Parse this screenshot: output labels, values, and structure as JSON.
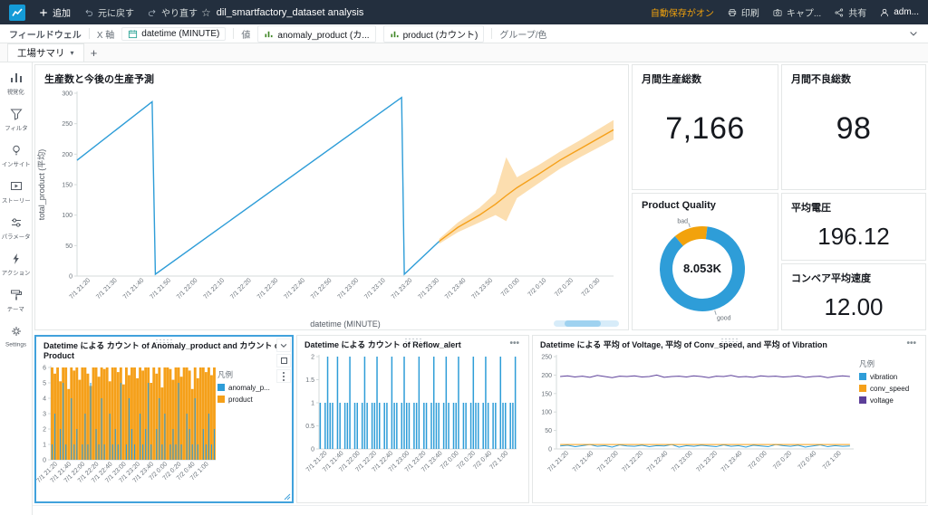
{
  "topbar": {
    "add": "追加",
    "undo": "元に戻す",
    "redo": "やり直す",
    "title": "dil_smartfactory_dataset analysis",
    "autosave": "自動保存がオン",
    "print": "印刷",
    "capture": "キャプ...",
    "share": "共有",
    "user": "adm..."
  },
  "fieldwells": {
    "label": "フィールドウェル",
    "x_axis": "X 軸",
    "x_field": "datetime (MINUTE)",
    "value_label": "値",
    "value_field_1": "anomaly_product (カ...",
    "value_field_2": "product (カウント)",
    "group_label": "グループ/色"
  },
  "tabs": {
    "active": "工場サマリ",
    "add": "+"
  },
  "sidebar": {
    "items": [
      {
        "label": "視覚化"
      },
      {
        "label": "フィルタ"
      },
      {
        "label": "インサイト"
      },
      {
        "label": "ストーリー"
      },
      {
        "label": "パラメータ"
      },
      {
        "label": "アクション"
      },
      {
        "label": "テーマ"
      },
      {
        "label": "Settings"
      }
    ]
  },
  "kpis": {
    "production": {
      "title": "月間生産総数",
      "value": "7,166"
    },
    "defects": {
      "title": "月間不良総数",
      "value": "98"
    },
    "voltage": {
      "title": "平均電圧",
      "value": "196.12"
    },
    "conveyor": {
      "title": "コンベア平均速度",
      "value": "12.00"
    }
  },
  "charts": {
    "bottom_xlabels": [
      "7/1 21:20",
      "7/1 21:40",
      "7/1 22:00",
      "7/1 22:20",
      "7/1 22:40",
      "7/1 23:00",
      "7/1 23:20",
      "7/1 23:40",
      "7/2 0:00",
      "7/2 0:20",
      "7/2 0:40",
      "7/2 1:00"
    ],
    "production": {
      "type": "line",
      "title": "生産数と今後の生産予測",
      "ylabel": "total_product (平均)",
      "xlabel": "datetime (MINUTE)",
      "ylim": [
        0,
        300
      ],
      "yticks": [
        0,
        50,
        100,
        150,
        200,
        250,
        300
      ],
      "xlabels": [
        "7/1 21:20",
        "7/1 21:30",
        "7/1 21:40",
        "7/1 21:50",
        "7/1 22:00",
        "7/1 22:10",
        "7/1 22:20",
        "7/1 22:30",
        "7/1 22:40",
        "7/1 22:50",
        "7/1 23:00",
        "7/1 23:10",
        "7/1 23:20",
        "7/1 23:30",
        "7/1 23:40",
        "7/1 23:50",
        "7/2 0:00",
        "7/2 0:10",
        "7/2 0:20",
        "7/2 0:30"
      ],
      "historical": {
        "name": "total_product",
        "color": "#2e9dd8",
        "points": [
          [
            0,
            190
          ],
          [
            14,
            286
          ],
          [
            14.6,
            3
          ],
          [
            60.5,
            293
          ],
          [
            61,
            3
          ],
          [
            67.5,
            57
          ]
        ]
      },
      "forecast": {
        "name": "forecast",
        "color": "#f5a01a",
        "x": [
          67.5,
          71,
          75,
          78,
          80,
          82,
          86,
          90,
          94,
          97,
          100
        ],
        "y": [
          57,
          80,
          100,
          118,
          132,
          145,
          167,
          190,
          210,
          225,
          240
        ],
        "lo": [
          53,
          72,
          88,
          100,
          90,
          128,
          152,
          176,
          196,
          210,
          224
        ],
        "hi": [
          61,
          88,
          112,
          136,
          195,
          162,
          182,
          204,
          224,
          240,
          256
        ]
      }
    },
    "quality": {
      "type": "donut",
      "title": "Product Quality",
      "center": "8.053K",
      "start_angle": -40,
      "slices": [
        {
          "label": "bad",
          "value": 13,
          "color": "#f2a20c"
        },
        {
          "label": "good",
          "value": 87,
          "color": "#2e9dd8"
        }
      ]
    },
    "anomaly": {
      "type": "bar",
      "title": "Datetime による カウント of Anomaly_product and カウント of Product",
      "ylim": [
        0,
        6
      ],
      "yticks": [
        0,
        1,
        2,
        3,
        4,
        5,
        6
      ],
      "legend_title": "凡例",
      "legend": [
        {
          "label": "anomaly_p...",
          "color": "#2e9dd8"
        },
        {
          "label": "product",
          "color": "#f5a01a"
        }
      ],
      "series": [
        {
          "name": "product",
          "color": "#f5a01a",
          "bw": 0.95,
          "values": [
            6,
            5.6,
            6,
            5.1,
            6,
            6,
            4.6,
            6,
            5.8,
            6,
            5.2,
            6,
            6,
            5.6,
            4.8,
            6,
            6,
            5.4,
            6,
            5.9,
            6,
            5.1,
            6,
            6,
            5.7,
            6,
            4.9,
            6,
            5.5,
            6,
            6,
            5.3,
            6,
            5.8,
            6,
            6,
            5,
            6,
            5.6,
            6,
            4.7,
            6,
            6,
            5.9,
            5.2,
            6,
            6,
            5.4,
            6,
            6,
            5.8,
            4.6,
            6,
            5.3,
            6,
            6,
            5.7,
            6,
            5.5,
            6
          ]
        },
        {
          "name": "anomaly_product",
          "color": "#2e9dd8",
          "bw": 0.35,
          "values": [
            1,
            3,
            0,
            2,
            5,
            1,
            0,
            4,
            1,
            2,
            0,
            1,
            3,
            1,
            5,
            0,
            2,
            1,
            4,
            1,
            0,
            3,
            1,
            2,
            1,
            5,
            0,
            1,
            4,
            2,
            1,
            0,
            3,
            1,
            2,
            5,
            1,
            0,
            2,
            4,
            1,
            3,
            0,
            1,
            2,
            1,
            5,
            1,
            0,
            3,
            2,
            1,
            4,
            1,
            0,
            2,
            1,
            3,
            1,
            2
          ]
        }
      ]
    },
    "reflow": {
      "type": "bar",
      "title": "Datetime による カウント of Reflow_alert",
      "ylim": [
        0,
        2
      ],
      "yticks": [
        0,
        0.5,
        1,
        1.5,
        2
      ],
      "series": [
        {
          "name": "reflow_alert",
          "color": "#2e9dd8",
          "bw": 0.55,
          "values": [
            1,
            0,
            1,
            2,
            1,
            1,
            0,
            2,
            1,
            0,
            1,
            1,
            2,
            0,
            1,
            1,
            0,
            1,
            2,
            1,
            0,
            1,
            1,
            2,
            1,
            0,
            1,
            1,
            0,
            2,
            1,
            1,
            0,
            1,
            2,
            1,
            1,
            0,
            1,
            1,
            2,
            0,
            1,
            1,
            0,
            1,
            2,
            1,
            1,
            0,
            1,
            2,
            1,
            0,
            1,
            1,
            2,
            0,
            1,
            1,
            0,
            1,
            2,
            1,
            1,
            0,
            1,
            2,
            1,
            0,
            1,
            1,
            0,
            2,
            1,
            1,
            0,
            1,
            1,
            2
          ]
        }
      ]
    },
    "sensors": {
      "type": "line",
      "title": "Datetime による 平均 of Voltage, 平均 of Conv_speed, and 平均 of Vibration",
      "ylim": [
        0,
        250
      ],
      "yticks": [
        0,
        50,
        100,
        150,
        200,
        250
      ],
      "legend_title": "凡例",
      "legend": [
        {
          "label": "vibration",
          "color": "#2e9dd8"
        },
        {
          "label": "conv_speed",
          "color": "#f5a01a"
        },
        {
          "label": "voltage",
          "color": "#5c3f99"
        }
      ],
      "series": [
        {
          "name": "voltage",
          "color": "#5c3f99",
          "values": [
            196,
            198,
            195,
            197,
            194,
            199,
            196,
            193,
            197,
            196,
            198,
            195,
            196,
            200,
            194,
            196,
            197,
            195,
            198,
            196,
            193,
            197,
            196,
            199,
            195,
            196,
            194,
            198,
            196,
            197,
            195,
            196,
            198,
            194,
            196,
            197,
            193,
            196,
            198,
            196
          ]
        },
        {
          "name": "vibration",
          "color": "#2e9dd8",
          "values": [
            8,
            10,
            6,
            9,
            12,
            7,
            9,
            5,
            11,
            8,
            7,
            10,
            6,
            9,
            8,
            12,
            5,
            9,
            7,
            10,
            8,
            6,
            11,
            7,
            9,
            5,
            10,
            8,
            6,
            12,
            9,
            7,
            10,
            5,
            8,
            11,
            6,
            9,
            7,
            8
          ]
        },
        {
          "name": "conv_speed",
          "color": "#f5a01a",
          "values": [
            12,
            12,
            12.1,
            12,
            11.9,
            12,
            12,
            12.1,
            12,
            12,
            11.9,
            12,
            12,
            12,
            12.1,
            12,
            11.9,
            12,
            12,
            12,
            12,
            12.1,
            12,
            11.9,
            12,
            12,
            12,
            12.1,
            12,
            12,
            11.9,
            12,
            12,
            12.1,
            12,
            12,
            11.9,
            12,
            12,
            12
          ]
        }
      ]
    }
  }
}
